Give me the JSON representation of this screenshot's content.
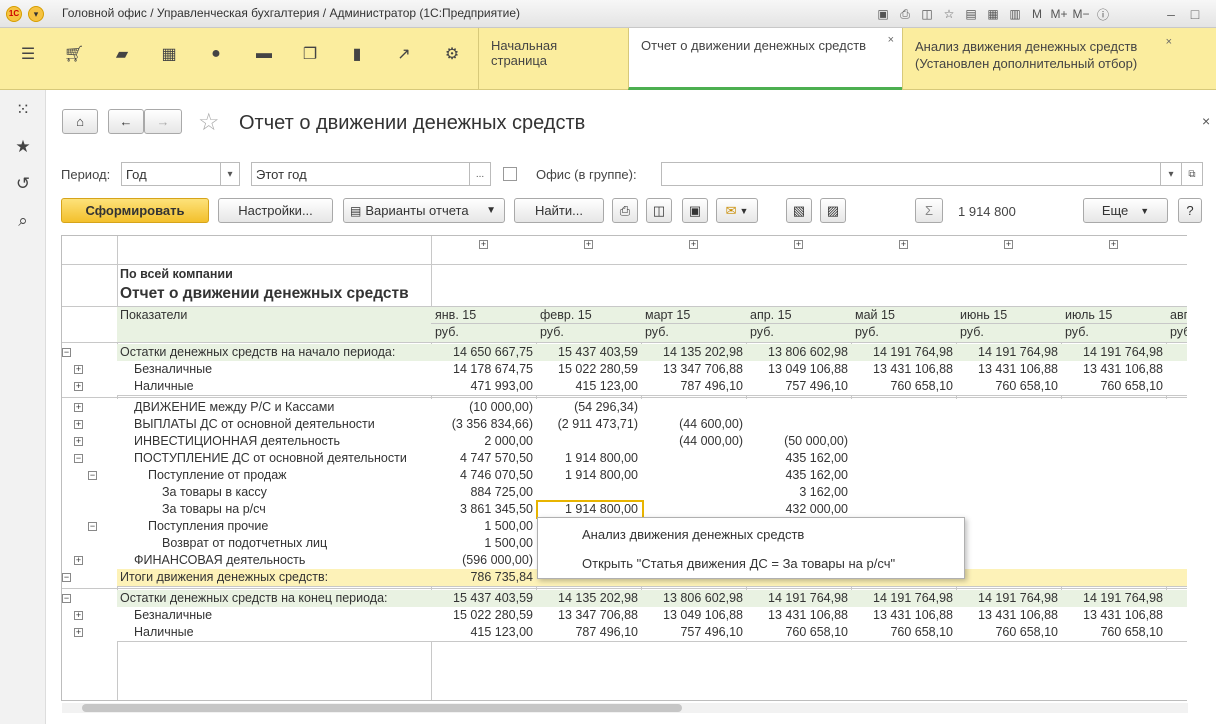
{
  "window": {
    "title": "Головной офис / Управленческая бухгалтерия / Администратор  (1С:Предприятие)",
    "logo_text": "1С"
  },
  "colors": {
    "accent": "#fbed9e",
    "button_primary": "#f6c342",
    "row_total": "#fdf2b8",
    "row_group": "#e9f2e2"
  },
  "tabs": [
    {
      "label": "Начальная страница"
    },
    {
      "label": "Отчет о движении денежных средств"
    },
    {
      "label": "Анализ движения денежных средств",
      "sub": "(Установлен дополнительный отбор)"
    }
  ],
  "page": {
    "title": "Отчет о движении денежных средств"
  },
  "form": {
    "period_label": "Период:",
    "period_value": "Год",
    "this_year": "Этот год",
    "office_label": "Офис (в группе):",
    "office_value": "",
    "generate": "Сформировать",
    "settings": "Настройки...",
    "variants": "Варианты отчета",
    "find": "Найти...",
    "sum_value": "1 914 800",
    "more": "Еще",
    "help": "?"
  },
  "report": {
    "company": "По всей компании",
    "title": "Отчет о движении денежных средств",
    "indicators_label": "Показатели",
    "months": [
      "янв. 15",
      "февр. 15",
      "март 15",
      "апр. 15",
      "май 15",
      "июнь 15",
      "июль 15",
      "авг"
    ],
    "currency": "руб.",
    "rows": [
      {
        "label": "Остатки денежных средств на начало периода:",
        "values": [
          "14 650 667,75",
          "15 437 403,59",
          "14 135 202,98",
          "13 806 602,98",
          "14 191 764,98",
          "14 191 764,98",
          "14 191 764,98"
        ]
      },
      {
        "label": "Безналичные",
        "values": [
          "14 178 674,75",
          "15 022 280,59",
          "13 347 706,88",
          "13 049 106,88",
          "13 431 106,88",
          "13 431 106,88",
          "13 431 106,88"
        ]
      },
      {
        "label": "Наличные",
        "values": [
          "471 993,00",
          "415 123,00",
          "787 496,10",
          "757 496,10",
          "760 658,10",
          "760 658,10",
          "760 658,10"
        ]
      },
      {
        "label": "ДВИЖЕНИЕ между Р/С и Кассами",
        "values": [
          "(10 000,00)",
          "(54 296,34)",
          "",
          "",
          "",
          "",
          ""
        ]
      },
      {
        "label": "ВЫПЛАТЫ ДС от основной деятельности",
        "values": [
          "(3 356 834,66)",
          "(2 911 473,71)",
          "(44 600,00)",
          "",
          "",
          "",
          ""
        ]
      },
      {
        "label": "ИНВЕСТИЦИОННАЯ деятельность",
        "values": [
          "2 000,00",
          "",
          "(44 000,00)",
          "(50 000,00)",
          "",
          "",
          ""
        ]
      },
      {
        "label": "ПОСТУПЛЕНИЕ ДС от основной деятельности",
        "values": [
          "4 747 570,50",
          "1 914 800,00",
          "",
          "435 162,00",
          "",
          "",
          ""
        ]
      },
      {
        "label": "Поступление от продаж",
        "values": [
          "4 746 070,50",
          "1 914 800,00",
          "",
          "435 162,00",
          "",
          "",
          ""
        ]
      },
      {
        "label": "За товары в кассу",
        "values": [
          "884 725,00",
          "",
          "",
          "3 162,00",
          "",
          "",
          ""
        ]
      },
      {
        "label": "За товары на р/сч",
        "values": [
          "3 861 345,50",
          "1 914 800,00",
          "",
          "432 000,00",
          "",
          "",
          ""
        ]
      },
      {
        "label": "Поступления прочие",
        "values": [
          "1 500,00",
          "",
          "",
          "",
          "",
          "",
          ""
        ]
      },
      {
        "label": "Возврат от подотчетных лиц",
        "values": [
          "1 500,00",
          "",
          "",
          "",
          "",
          "",
          ""
        ]
      },
      {
        "label": "ФИНАНСОВАЯ деятельность",
        "values": [
          "(596 000,00)",
          "",
          "",
          "",
          "",
          "",
          ""
        ]
      },
      {
        "label": "Итоги движения денежных средств:",
        "values": [
          "786 735,84",
          "",
          "",
          "",
          "",
          "",
          ""
        ]
      },
      {
        "label": "Остатки денежных средств на конец периода:",
        "values": [
          "15 437 403,59",
          "14 135 202,98",
          "13 806 602,98",
          "14 191 764,98",
          "14 191 764,98",
          "14 191 764,98",
          "14 191 764,98"
        ]
      },
      {
        "label": "Безналичные",
        "values": [
          "15 022 280,59",
          "13 347 706,88",
          "13 049 106,88",
          "13 431 106,88",
          "13 431 106,88",
          "13 431 106,88",
          "13 431 106,88"
        ]
      },
      {
        "label": "Наличные",
        "values": [
          "415 123,00",
          "787 496,10",
          "757 496,10",
          "760 658,10",
          "760 658,10",
          "760 658,10",
          "760 658,10"
        ]
      }
    ]
  },
  "context_menu": {
    "items": [
      "Анализ движения денежных средств",
      "Открыть \"Статья движения ДС = За товары на р/сч\""
    ]
  }
}
